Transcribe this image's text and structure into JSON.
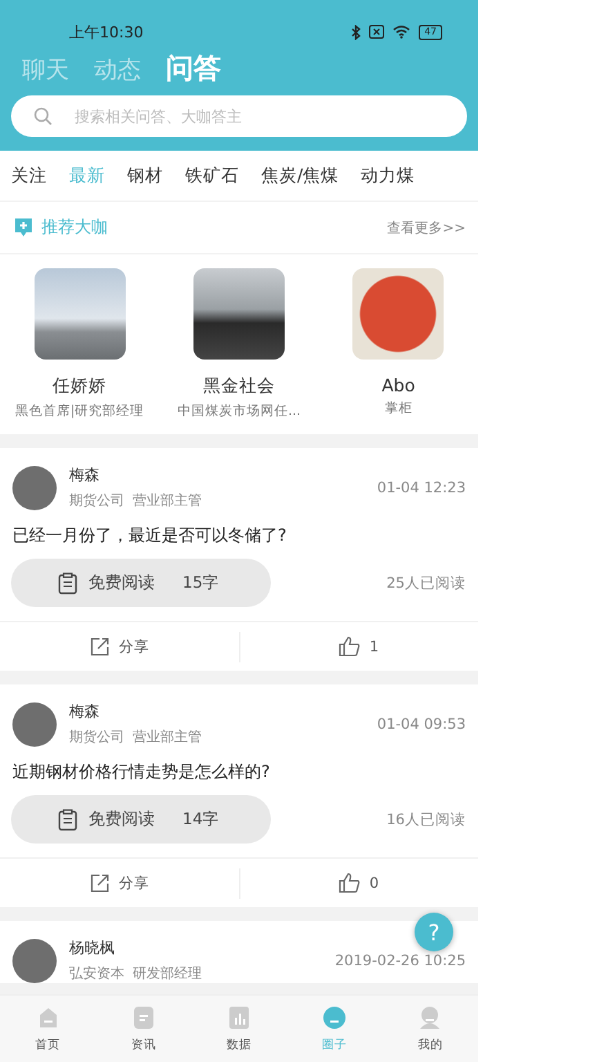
{
  "status_bar": {
    "time": "上午10:30",
    "battery": "47"
  },
  "top_tabs": [
    {
      "label": "聊天",
      "selected": false
    },
    {
      "label": "动态",
      "selected": false
    },
    {
      "label": "问答",
      "selected": true
    }
  ],
  "search": {
    "placeholder": "搜索相关问答、大咖答主"
  },
  "categories": [
    {
      "label": "关注",
      "selected": false
    },
    {
      "label": "最新",
      "selected": true
    },
    {
      "label": "钢材",
      "selected": false
    },
    {
      "label": "铁矿石",
      "selected": false
    },
    {
      "label": "焦炭/焦煤",
      "selected": false
    },
    {
      "label": "动力煤",
      "selected": false
    }
  ],
  "recommend": {
    "title": "推荐大咖",
    "more": "查看更多>>"
  },
  "experts": [
    {
      "name": "任娇娇",
      "title": "黑色首席|研究部经理"
    },
    {
      "name": "黑金社会",
      "title": "中国煤炭市场网任..."
    },
    {
      "name": "Abo",
      "title": "掌柜"
    }
  ],
  "posts": [
    {
      "author": "梅森",
      "company": "期货公司",
      "role": "营业部主管",
      "time": "01-04 12:23",
      "question": "已经一月份了，最近是否可以冬储了?",
      "read_label": "免费阅读",
      "word_count": "15字",
      "readers": "25人已阅读",
      "share": "分享",
      "likes": "1"
    },
    {
      "author": "梅森",
      "company": "期货公司",
      "role": "营业部主管",
      "time": "01-04 09:53",
      "question": "近期钢材价格行情走势是怎么样的?",
      "read_label": "免费阅读",
      "word_count": "14字",
      "readers": "16人已阅读",
      "share": "分享",
      "likes": "0"
    },
    {
      "author": "杨晓枫",
      "company": "弘安资本",
      "role": "研发部经理",
      "time": "2019-02-26 10:25"
    }
  ],
  "help_button": "?",
  "bottom_nav": [
    {
      "label": "首页",
      "kind": "home",
      "selected": false
    },
    {
      "label": "资讯",
      "kind": "news",
      "selected": false
    },
    {
      "label": "数据",
      "kind": "data",
      "selected": false
    },
    {
      "label": "圈子",
      "kind": "circle",
      "selected": true
    },
    {
      "label": "我的",
      "kind": "me",
      "selected": false
    }
  ]
}
